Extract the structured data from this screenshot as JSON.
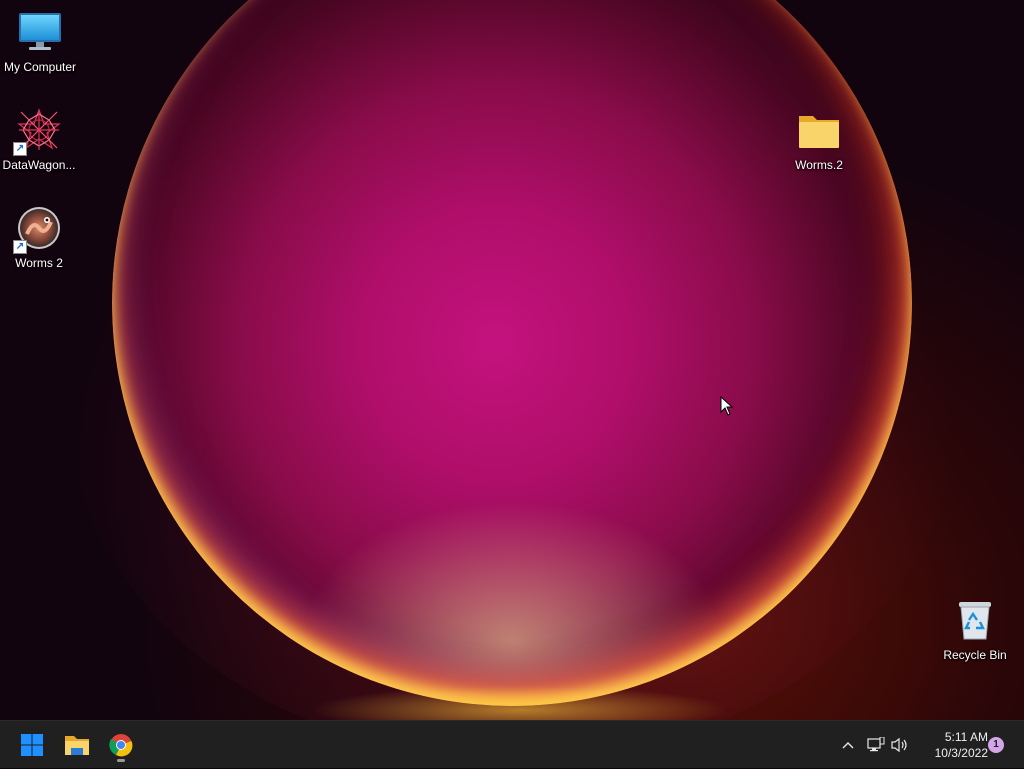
{
  "desktop": {
    "icons": [
      {
        "label": "My Computer",
        "icon": "monitor-icon"
      },
      {
        "label": "DataWagon...",
        "icon": "datawagon-app-icon",
        "shortcut": true
      },
      {
        "label": "Worms 2",
        "icon": "worms2-app-icon",
        "shortcut": true
      },
      {
        "label": "Worms.2",
        "icon": "folder-icon"
      },
      {
        "label": "Recycle Bin",
        "icon": "recycle-bin-icon"
      }
    ]
  },
  "taskbar": {
    "pinned": [
      {
        "name": "Start",
        "icon": "windows-start-icon"
      },
      {
        "name": "File Explorer",
        "icon": "file-explorer-icon"
      },
      {
        "name": "Google Chrome",
        "icon": "chrome-icon",
        "running": true
      }
    ],
    "tray": {
      "chevron": "show-hidden-icons-chevron",
      "network": "network-icon",
      "volume": "volume-icon"
    },
    "clock": {
      "time": "5:11 AM",
      "date": "10/3/2022"
    },
    "notification_count": "1"
  },
  "colors": {
    "taskbar": "#202020",
    "windows_blue": "#1e90ff",
    "folder_yellow": "#f5c542",
    "wallpaper_magenta": "#c4127e"
  }
}
